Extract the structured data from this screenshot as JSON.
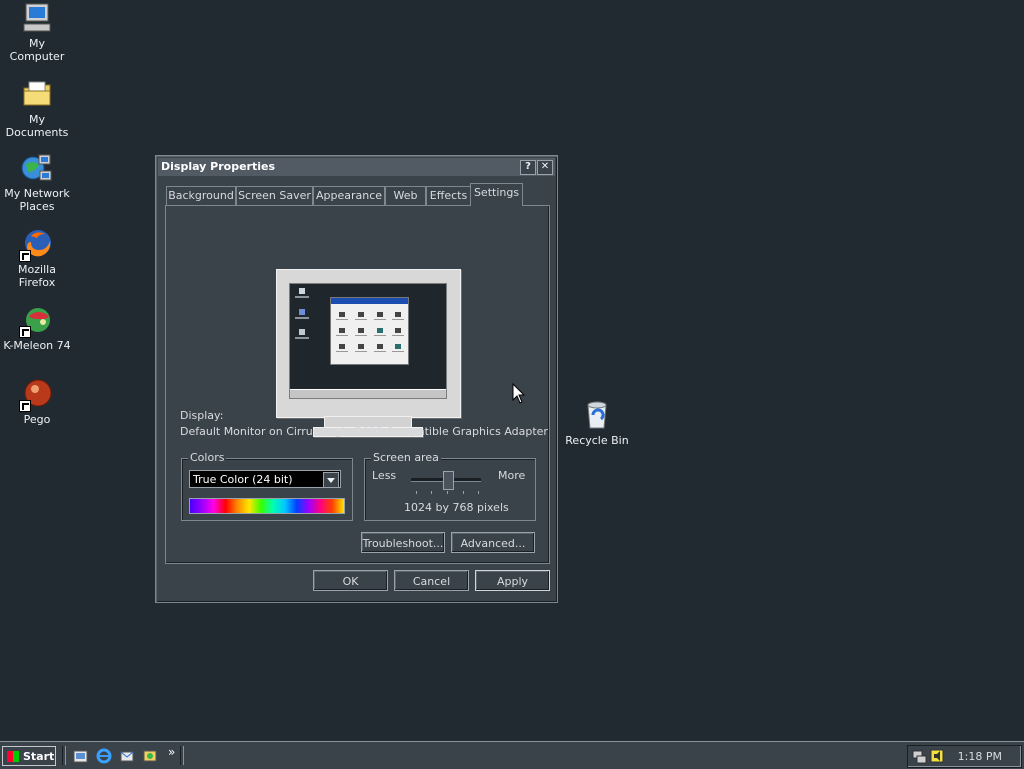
{
  "desktop": {
    "icons": [
      {
        "label": "My Computer"
      },
      {
        "label": "My Documents"
      },
      {
        "label": "My Network Places"
      },
      {
        "label": "Mozilla Firefox"
      },
      {
        "label": "K-Meleon 74"
      },
      {
        "label": "Pego"
      },
      {
        "label": "Recycle Bin"
      }
    ]
  },
  "window": {
    "title": "Display Properties",
    "help_button": "?",
    "close_button": "✕",
    "tabs": [
      {
        "label": "Background"
      },
      {
        "label": "Screen Saver"
      },
      {
        "label": "Appearance"
      },
      {
        "label": "Web"
      },
      {
        "label": "Effects"
      },
      {
        "label": "Settings"
      }
    ],
    "active_tab": "Settings",
    "display_label": "Display:",
    "display_value": "Default Monitor on Cirrus Logic 5446 Compatible Graphics Adapter",
    "colors": {
      "title": "Colors",
      "selected": "True Color (24 bit)"
    },
    "screen_area": {
      "title": "Screen area",
      "less": "Less",
      "more": "More",
      "value_text": "1024 by 768 pixels",
      "slider_position": 0.5
    },
    "buttons": {
      "troubleshoot": "Troubleshoot...",
      "advanced": "Advanced...",
      "ok": "OK",
      "cancel": "Cancel",
      "apply": "Apply"
    }
  },
  "taskbar": {
    "start_label": "Start",
    "overflow": "»",
    "clock": "1:18 PM"
  }
}
